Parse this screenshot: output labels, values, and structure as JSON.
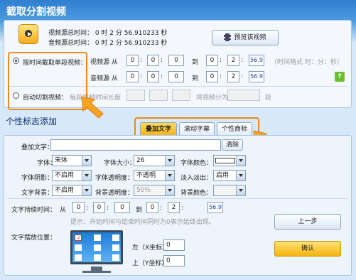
{
  "app": {
    "title": "截取分割视频"
  },
  "info": {
    "video_line": "视频源总时间： 0 时 2 分 56.910233 秒",
    "audio_line": "音频源总时间： 0 时 2 分 56.910233 秒",
    "preview_button": "预览该视频"
  },
  "segment": {
    "option_label": "按时间截取单段视频：",
    "video_src": "视频源 从",
    "audio_src": "音频源 从",
    "to": "到",
    "video_from": [
      "0",
      "0",
      "0"
    ],
    "video_to": [
      "0",
      "2",
      "56.9"
    ],
    "audio_from": [
      "0",
      "0",
      "0"
    ],
    "audio_to": [
      "0",
      "2",
      "56.9"
    ],
    "time_format": "（时间格式 时：分：秒）",
    "help_icon": "?"
  },
  "auto_split": {
    "option_label": "自动切割视频：",
    "per_segment": "每段视频时间长度",
    "split_into": "将视频分为",
    "unit": "段"
  },
  "logo_section": {
    "title": "个性标志添加",
    "tabs": [
      "叠加文字",
      "滚动字幕",
      "个性商标"
    ]
  },
  "overlay": {
    "text_label": "叠加文字：",
    "clear_button": "清除",
    "font_label": "字体：",
    "font_value": "宋体",
    "size_label": "字体大小：",
    "size_value": "26",
    "color_label": "字体颜色：",
    "shadow_label": "字体阴影：",
    "shadow_value": "不启用",
    "opacity_label": "字体透明度：",
    "opacity_value": "不透明",
    "fade_label": "淡入淡出：",
    "fade_value": "启用",
    "bg_label": "文字背景：",
    "bg_value": "不启用",
    "bg_opacity_label": "背景透明度：",
    "bg_opacity_value": "50%",
    "bg_color_label": "背景颜色："
  },
  "duration": {
    "label": "文字持续时间：",
    "from": "从",
    "to": "到",
    "from_vals": [
      "0",
      "0",
      "0"
    ],
    "to_vals": [
      "0",
      "2",
      "56.9"
    ],
    "hint": "提示：开始时间与结束时间同时为0表示始终出现。"
  },
  "position": {
    "label": "文字摆放位置：",
    "left_label": "左（X坐标）",
    "left_value": "0",
    "top_label": "上（Y坐标）",
    "top_value": "0"
  },
  "nav": {
    "prev_button": "上一步",
    "ok_button": "确认"
  },
  "colors": {
    "highlight": "#e98a22",
    "title_bar": "#2f7fd0",
    "ok_button": "#f4b410"
  }
}
